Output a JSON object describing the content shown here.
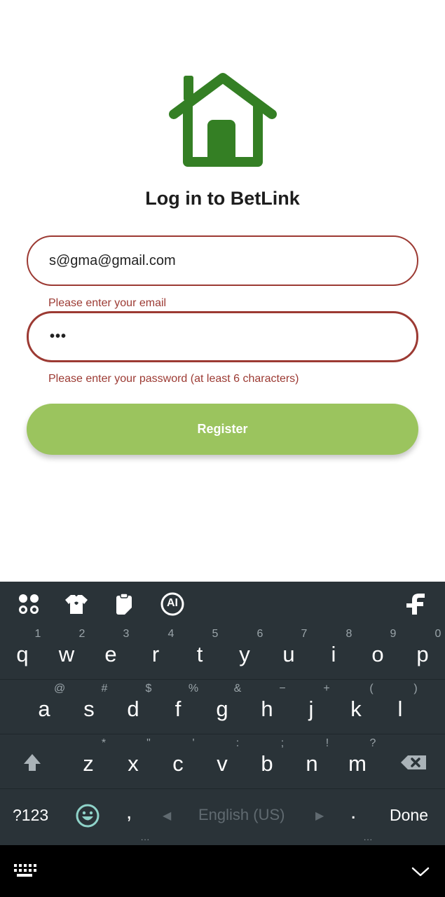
{
  "app": {
    "title": "Log in to BetLink",
    "logo_icon": "house-icon",
    "brand_color": "#347f24"
  },
  "form": {
    "email_value": "s@gma@gmail.com",
    "email_error": "Please enter your email",
    "password_value": "•••",
    "password_error": "Please enter your password (at least 6 characters)",
    "register_label": "Register",
    "error_color": "#9c3a33",
    "button_color": "#9bc45e"
  },
  "keyboard": {
    "toolbar_icons": [
      "apps-icon",
      "shirt-icon",
      "clipboard-icon",
      "ai-icon",
      "fleksy-logo-icon"
    ],
    "ai_label": "AI",
    "row1": [
      {
        "key": "q",
        "hint": "1"
      },
      {
        "key": "w",
        "hint": "2"
      },
      {
        "key": "e",
        "hint": "3"
      },
      {
        "key": "r",
        "hint": "4"
      },
      {
        "key": "t",
        "hint": "5"
      },
      {
        "key": "y",
        "hint": "6"
      },
      {
        "key": "u",
        "hint": "7"
      },
      {
        "key": "i",
        "hint": "8"
      },
      {
        "key": "o",
        "hint": "9"
      },
      {
        "key": "p",
        "hint": "0"
      }
    ],
    "row2": [
      {
        "key": "a",
        "hint": "@"
      },
      {
        "key": "s",
        "hint": "#"
      },
      {
        "key": "d",
        "hint": "$"
      },
      {
        "key": "f",
        "hint": "%"
      },
      {
        "key": "g",
        "hint": "&"
      },
      {
        "key": "h",
        "hint": "−"
      },
      {
        "key": "j",
        "hint": "+"
      },
      {
        "key": "k",
        "hint": "("
      },
      {
        "key": "l",
        "hint": ")"
      }
    ],
    "row3": [
      {
        "key": "z",
        "hint": "*"
      },
      {
        "key": "x",
        "hint": "\""
      },
      {
        "key": "c",
        "hint": "'"
      },
      {
        "key": "v",
        "hint": ":"
      },
      {
        "key": "b",
        "hint": ";"
      },
      {
        "key": "n",
        "hint": "!"
      },
      {
        "key": "m",
        "hint": "?"
      }
    ],
    "symbols_label": "?123",
    "comma": ",",
    "space_label": "English (US)",
    "period": ".",
    "done_label": "Done",
    "more_dots": "..."
  }
}
